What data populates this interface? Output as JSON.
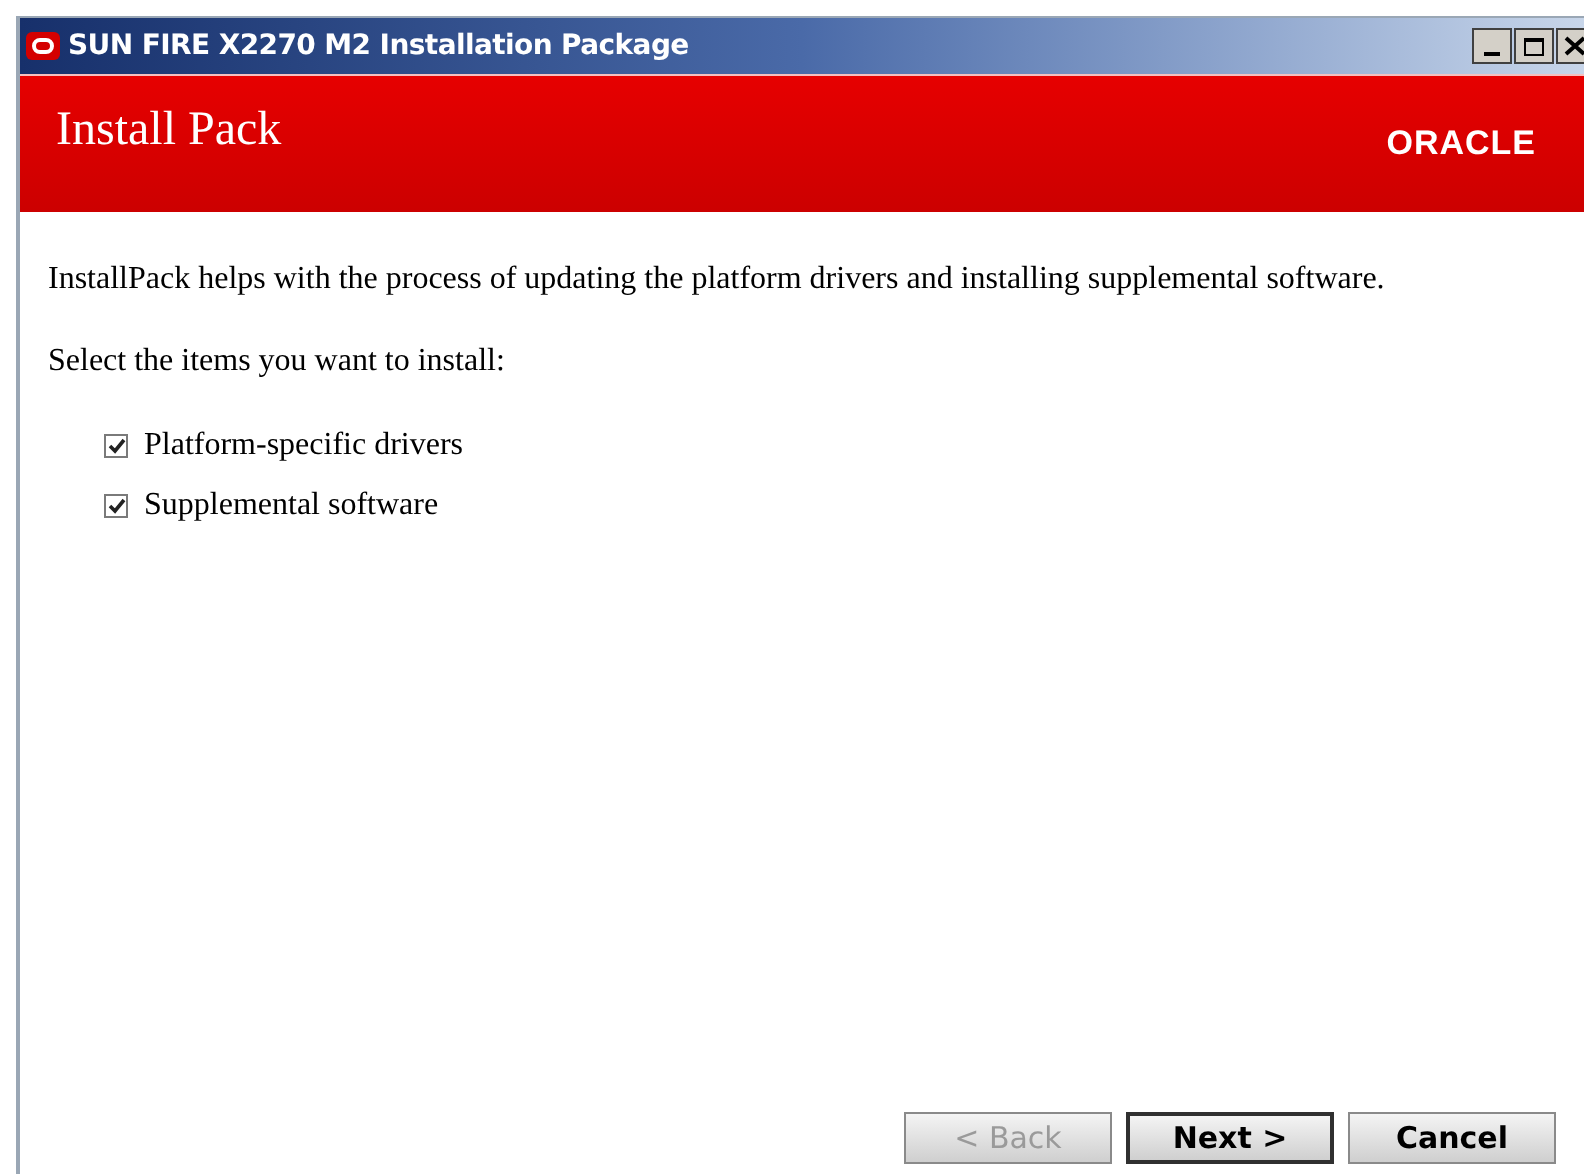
{
  "window": {
    "title": "SUN FIRE X2270 M2 Installation Package"
  },
  "header": {
    "title": "Install Pack",
    "logo": "ORACLE"
  },
  "intro": "InstallPack helps with the process of updating the platform drivers and installing supplemental software.",
  "prompt": "Select the items you want to install:",
  "items": [
    {
      "label": "Platform-specific drivers",
      "checked": true
    },
    {
      "label": "Supplemental software",
      "checked": true
    }
  ],
  "buttons": [
    {
      "label": "< Back",
      "disabled": true,
      "default": false
    },
    {
      "label": "Next >",
      "disabled": false,
      "default": true
    },
    {
      "label": "Cancel",
      "disabled": false,
      "default": false
    }
  ]
}
